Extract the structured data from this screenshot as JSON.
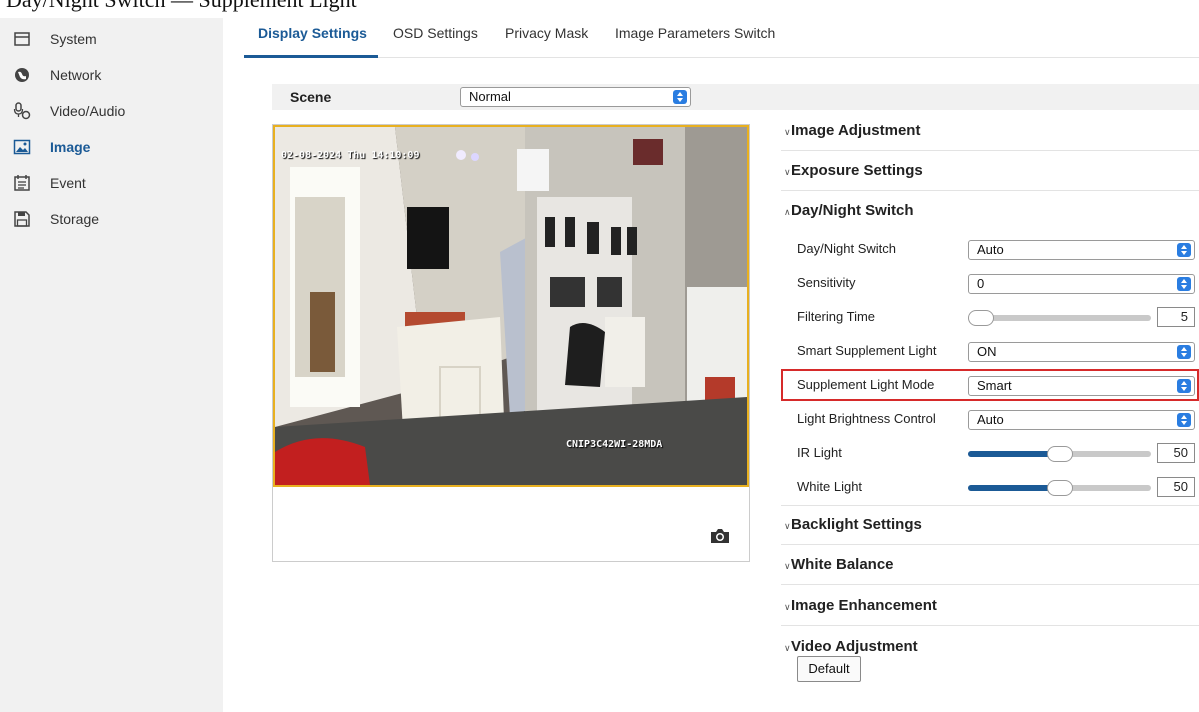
{
  "caption": "Day/Night Switch — Supplement Light",
  "sidebar": {
    "items": [
      {
        "label": "System",
        "icon": "system-icon"
      },
      {
        "label": "Network",
        "icon": "network-icon"
      },
      {
        "label": "Video/Audio",
        "icon": "video-audio-icon"
      },
      {
        "label": "Image",
        "icon": "image-icon",
        "active": true
      },
      {
        "label": "Event",
        "icon": "event-icon"
      },
      {
        "label": "Storage",
        "icon": "storage-icon"
      }
    ]
  },
  "tabs": [
    {
      "label": "Display Settings",
      "active": true
    },
    {
      "label": "OSD Settings"
    },
    {
      "label": "Privacy Mask"
    },
    {
      "label": "Image Parameters Switch"
    }
  ],
  "scene": {
    "label": "Scene",
    "value": "Normal"
  },
  "video": {
    "osd_datetime": "02-08-2024 Thu 14:10:09",
    "osd_camera_name": "CNIP3C42WI-28MDA"
  },
  "panel": {
    "image_adjustment": "Image Adjustment",
    "exposure_settings": "Exposure Settings",
    "day_night_switch": "Day/Night Switch",
    "backlight_settings": "Backlight Settings",
    "white_balance": "White Balance",
    "image_enhancement": "Image Enhancement",
    "video_adjustment": "Video Adjustment"
  },
  "day_night": {
    "switch": {
      "label": "Day/Night Switch",
      "value": "Auto"
    },
    "sensitivity": {
      "label": "Sensitivity",
      "value": "0"
    },
    "filtering_time": {
      "label": "Filtering Time",
      "value": "5",
      "level": 0
    },
    "smart_light": {
      "label": "Smart Supplement Light",
      "value": "ON"
    },
    "light_mode": {
      "label": "Supplement Light Mode",
      "value": "Smart"
    },
    "brightness": {
      "label": "Light Brightness Control",
      "value": "Auto"
    },
    "ir_light": {
      "label": "IR Light",
      "value": "50",
      "level": 0.5
    },
    "white_light": {
      "label": "White Light",
      "value": "50",
      "level": 0.5
    }
  },
  "default_button": "Default",
  "colors": {
    "accent": "#1b5a96",
    "select_arrow": "#2a7de1",
    "highlight": "#d62a2a",
    "video_border": "#e8b020"
  }
}
